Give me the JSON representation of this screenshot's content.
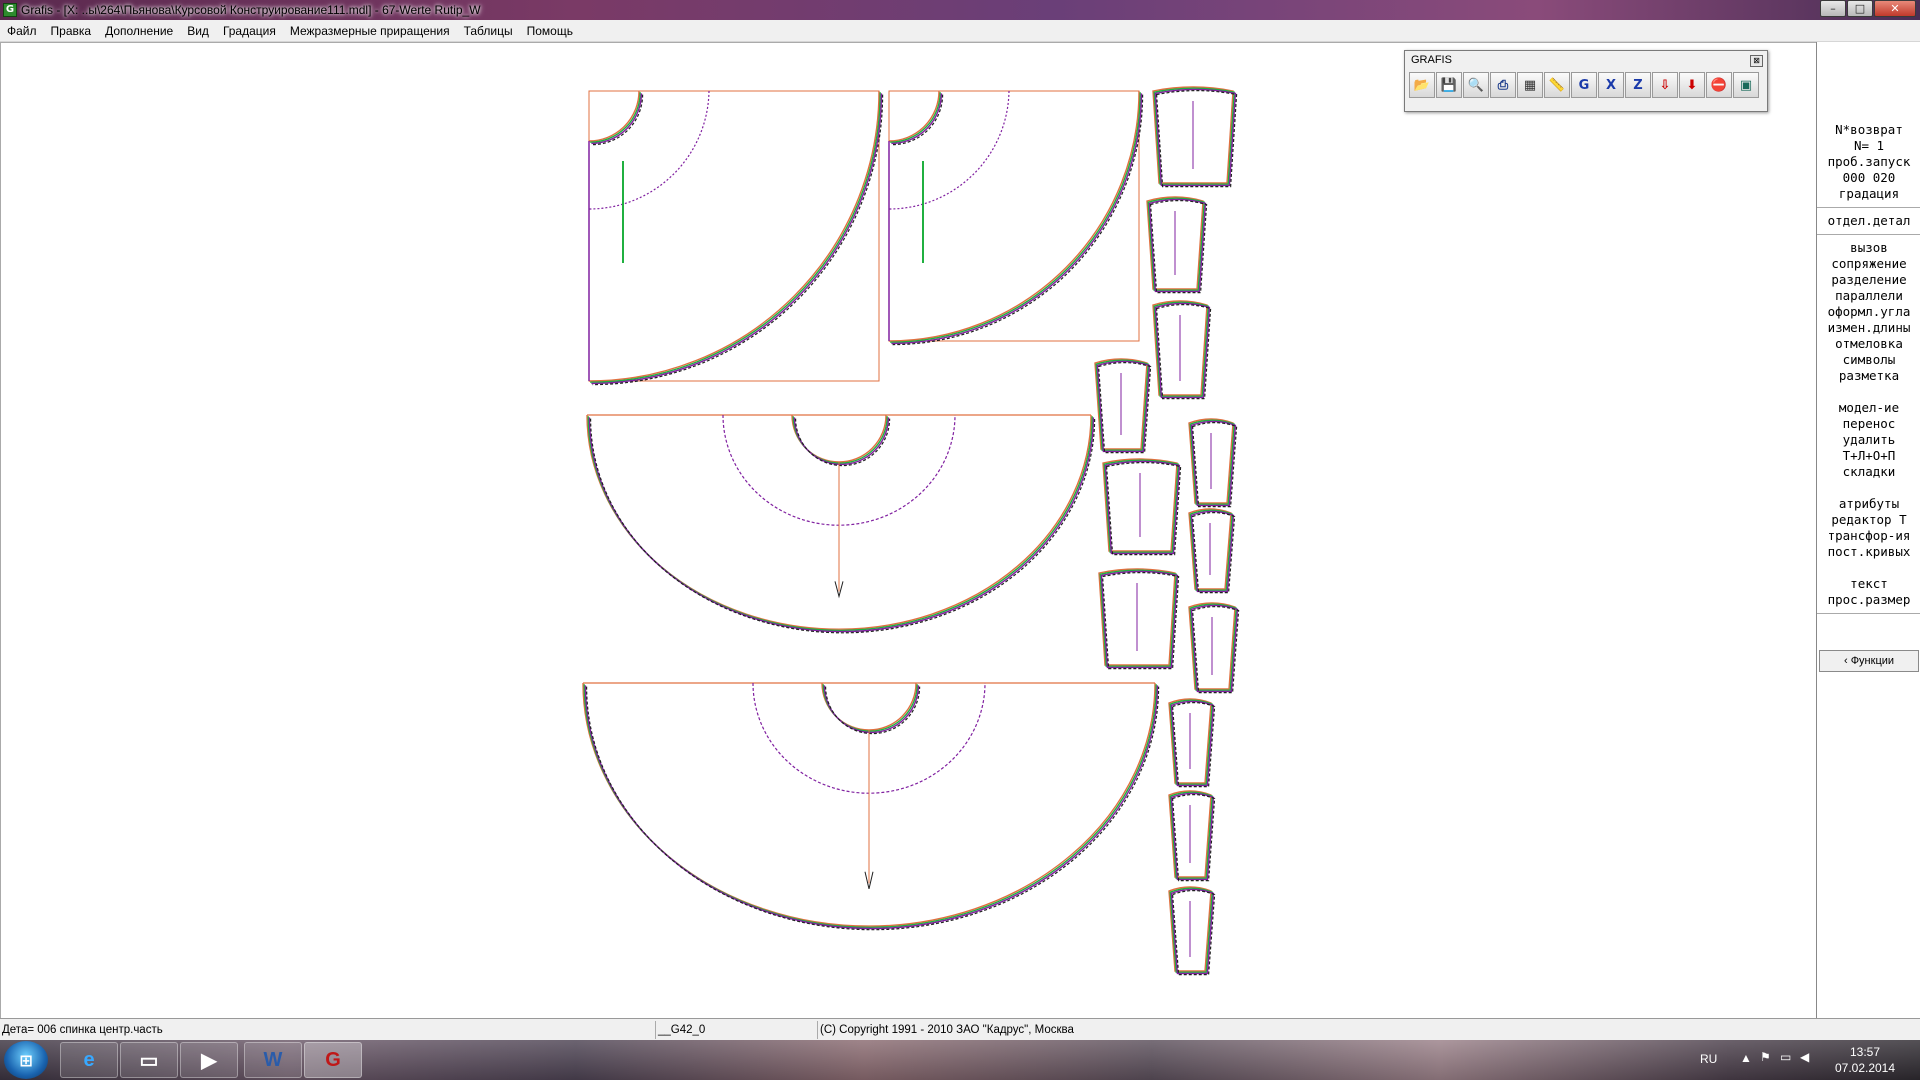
{
  "window": {
    "title": "Grafis - [X: ..ы\\264\\Пьянова\\Курсовой Конструирование111.mdl] - 67-Werte Rutip_W",
    "app_icon": "G",
    "controls": {
      "minimize": "–",
      "maximize": "□",
      "close": "✕"
    }
  },
  "menu": [
    "Файл",
    "Правка",
    "Дополнение",
    "Вид",
    "Градация",
    "Межразмерные приращения",
    "Таблицы",
    "Помощь"
  ],
  "toolbox": {
    "title": "GRAFIS",
    "close": "⊠",
    "tools": [
      {
        "name": "open-icon",
        "glyph": "📂",
        "color": "#c79a00"
      },
      {
        "name": "save-icon",
        "glyph": "💾",
        "color": "#333333"
      },
      {
        "name": "magnifier-icon",
        "glyph": "🔍",
        "color": "#1a5fb4"
      },
      {
        "name": "print-icon",
        "glyph": "⎙",
        "color": "#1a3a8a"
      },
      {
        "name": "layers-icon",
        "glyph": "▦",
        "color": "#333333"
      },
      {
        "name": "ruler-icon",
        "glyph": "📏",
        "color": "#c8a000"
      },
      {
        "name": "g-icon",
        "glyph": "G",
        "color": "#1a3aaa"
      },
      {
        "name": "x-icon",
        "glyph": "X",
        "color": "#1a3aaa"
      },
      {
        "name": "z-icon",
        "glyph": "Z",
        "color": "#1a3aaa"
      },
      {
        "name": "arrow-down-icon",
        "glyph": "⇩",
        "color": "#cc0000"
      },
      {
        "name": "arrow-down-bold-icon",
        "glyph": "⬇",
        "color": "#cc0000"
      },
      {
        "name": "stop-icon",
        "glyph": "⛔",
        "color": "#cc0000"
      },
      {
        "name": "calculator-icon",
        "glyph": "▣",
        "color": "#1a6a5a"
      }
    ]
  },
  "right_panel": {
    "group1": [
      "N*возврат",
      "N=  1",
      "проб.запуск",
      "000 020",
      "градация"
    ],
    "group2": [
      "отдел.детал"
    ],
    "group3": [
      "вызов",
      "сопряжение",
      "разделение",
      "параллели",
      "оформл.угла",
      "измен.длины",
      "отмеловка",
      "символы",
      "разметка"
    ],
    "group4": [
      "модел-ие",
      "перенос",
      "удалить",
      "Т+Л+О+П",
      "складки"
    ],
    "group5": [
      "атрибуты",
      "редактор Т",
      "трансфор-ия",
      "пост.кривых"
    ],
    "group6": [
      "текст",
      "прос.размер"
    ],
    "functions_button": "‹ Функции"
  },
  "status": {
    "detail": "Дета= 006  спинка центр.часть",
    "size": "__G42_0",
    "copyright": "(C) Copyright 1991 - 2010 ЗАО \"Кадрус\", Москва"
  },
  "taskbar": {
    "start": "⊞",
    "apps": [
      {
        "name": "ie-icon",
        "label": "e"
      },
      {
        "name": "explorer-icon",
        "label": "▭"
      },
      {
        "name": "media-player-icon",
        "label": "▶"
      },
      {
        "name": "word-icon",
        "label": "W"
      },
      {
        "name": "grafis-icon",
        "label": "G"
      }
    ],
    "lang": "RU",
    "time": "13:57",
    "date": "07.02.2014"
  },
  "colors": {
    "pattern_outline": "#e07040",
    "pattern_green": "#20b040",
    "pattern_purple": "#8020a0",
    "pattern_dark": "#202020"
  }
}
